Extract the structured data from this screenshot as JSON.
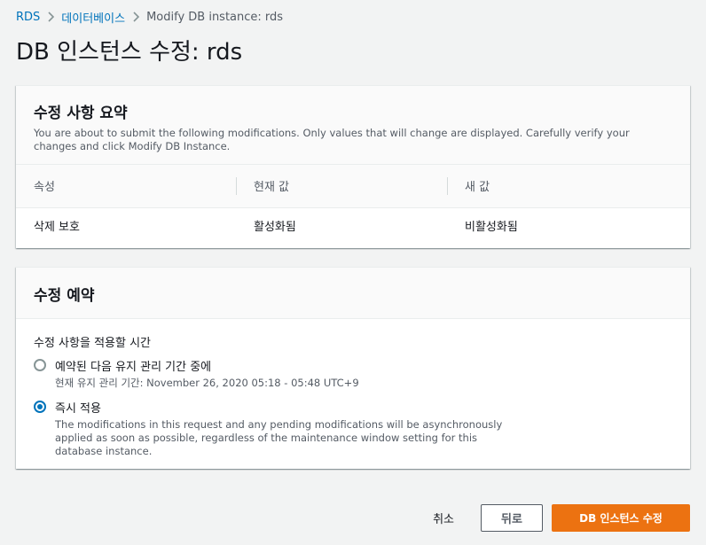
{
  "breadcrumb": {
    "items": [
      "RDS",
      "데이터베이스"
    ],
    "current": "Modify DB instance: rds"
  },
  "page_title": "DB 인스턴스 수정: rds",
  "summary": {
    "title": "수정 사항 요약",
    "description": "You are about to submit the following modifications. Only values that will change are displayed. Carefully verify your changes and click Modify DB Instance.",
    "columns": [
      "속성",
      "현재 값",
      "새 값"
    ],
    "rows": [
      {
        "attribute": "삭제 보호",
        "current": "활성화됨",
        "new": "비활성화됨"
      }
    ]
  },
  "schedule": {
    "title": "수정 예약",
    "field_label": "수정 사항을 적용할 시간",
    "options": [
      {
        "label": "예약된 다음 유지 관리 기간 중에",
        "description": "현재 유지 관리 기간: November 26, 2020 05:18 - 05:48 UTC+9",
        "selected": false
      },
      {
        "label": "즉시 적용",
        "description": "The modifications in this request and any pending modifications will be asynchronously applied as soon as possible, regardless of the maintenance window setting for this database instance.",
        "selected": true
      }
    ]
  },
  "footer": {
    "cancel_label": "취소",
    "back_label": "뒤로",
    "submit_label": "DB 인스턴스 수정"
  },
  "colors": {
    "link": "#0073bb",
    "primary": "#ec7211",
    "radio_selected": "#0073bb"
  }
}
